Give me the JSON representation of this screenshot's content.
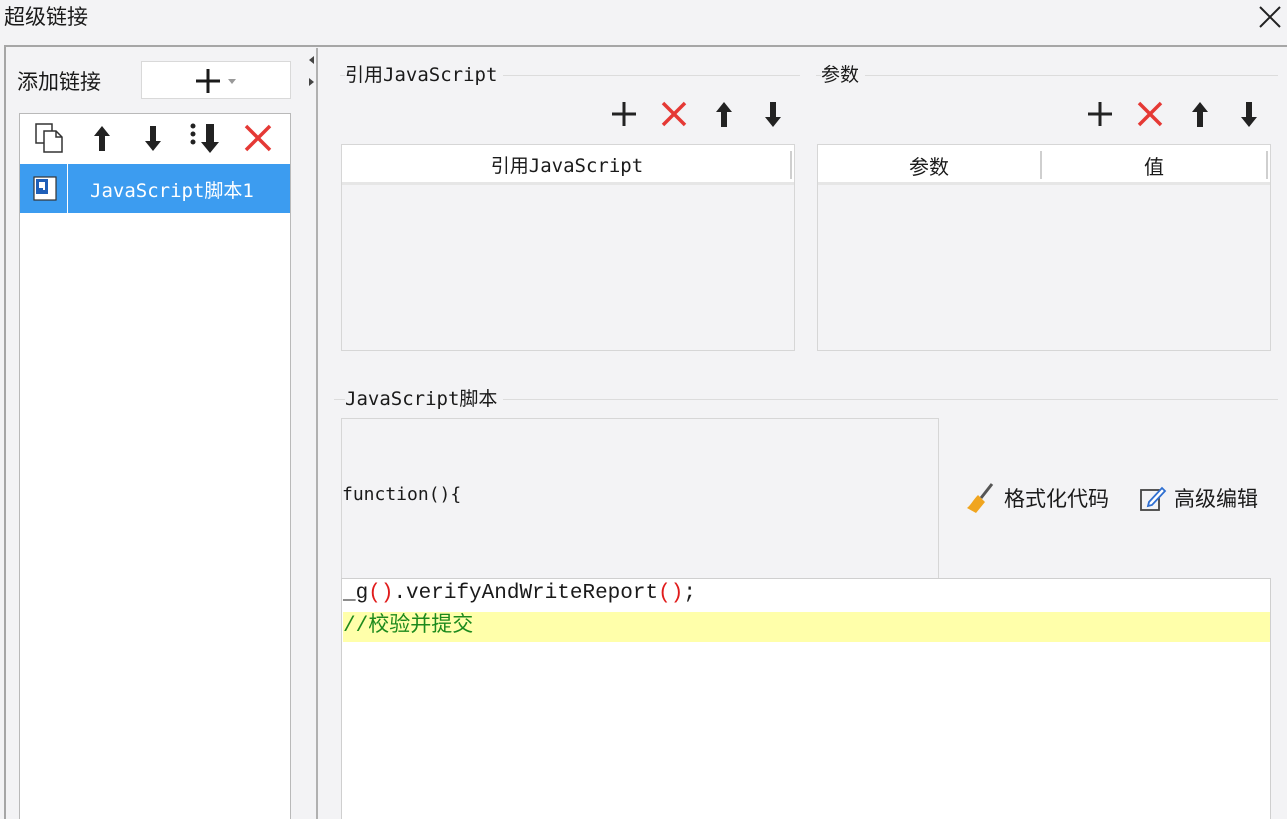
{
  "window": {
    "title": "超级链接",
    "close_icon": "close-icon"
  },
  "left_panel": {
    "add_link_label": "添加链接",
    "add_combo_icon": "plus-dropdown-icon",
    "toolbar_icons": [
      "copy-icon",
      "arrow-up-icon",
      "arrow-down-icon",
      "move-to-bottom-icon",
      "delete-icon"
    ],
    "items": [
      {
        "label": "JavaScript脚本1",
        "icon": "script-file-icon",
        "selected": true
      }
    ]
  },
  "refs_section": {
    "title": "引用JavaScript",
    "column": "引用JavaScript",
    "rows": []
  },
  "params_section": {
    "title": "参数",
    "columns": [
      "参数",
      "值"
    ],
    "rows": []
  },
  "script_section": {
    "title": "JavaScript脚本",
    "signature": "function(){",
    "format_button": "格式化代码",
    "advanced_button": "高级编辑",
    "code": {
      "line1_prefix": "_g",
      "line1_p1": "()",
      "line1_mid": ".verifyAndWriteReport",
      "line1_p2": "()",
      "line1_suffix": ";",
      "line2": "//校验并提交"
    }
  },
  "colors": {
    "selection": "#3c9cf0",
    "delete": "#e53935",
    "comment": "#1d8a1d",
    "highlight_line": "#ffffaa",
    "paren": "#e01b1b"
  }
}
